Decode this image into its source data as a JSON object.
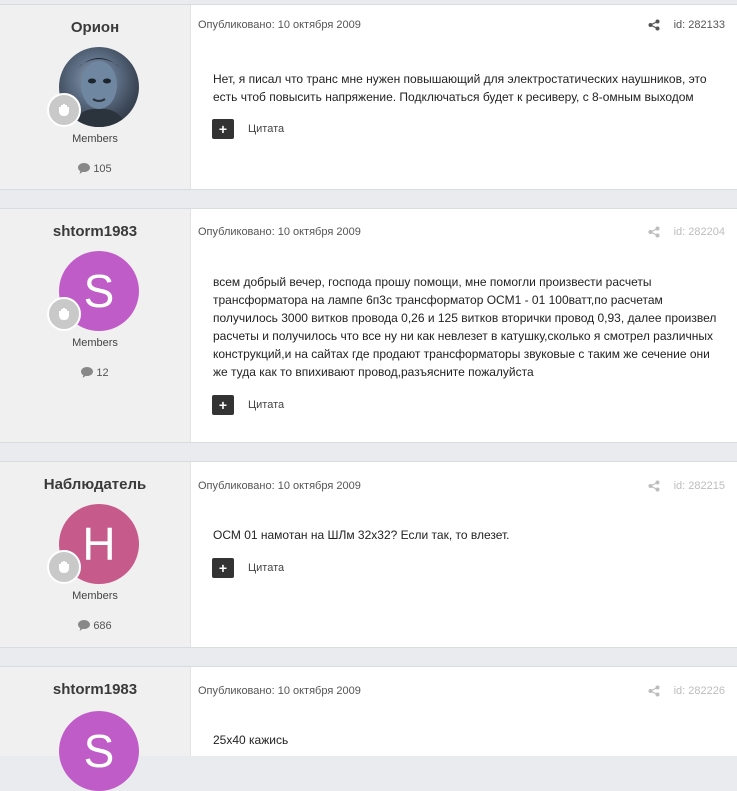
{
  "posts": [
    {
      "author": "Орион",
      "group": "Members",
      "post_count": "105",
      "date": "Опубликовано: 10 октября 2009",
      "id_label": "id: 282133",
      "content_lines": [
        "Нет, я писал что транс мне нужен повышающий для электростатических наушников, это",
        "есть чтоб повысить напряжение. Подключаться будет к ресиверу, с 8-омным выходом"
      ],
      "quote_label": "Цитата"
    },
    {
      "author": "shtorm1983",
      "avatar_letter": "S",
      "group": "Members",
      "post_count": "12",
      "date": "Опубликовано: 10 октября 2009",
      "id_label": "id: 282204",
      "content_lines": [
        "всем добрый вечер, господа прошу помощи, мне помогли произвести расчеты",
        "трансформатора на лампе 6п3с трансформатор ОСМ1 - 01 100ватт,по расчетам",
        "получилось 3000 витков провода 0,26 и 125 витков вторички провод 0,93, далее произвел",
        "расчеты и получилось что все ну ни как невлезет в катушку,сколько я смотрел различных",
        "конструкций,и на сайтах где продают трансформаторы звуковые с таким же сечение они",
        "же туда как то впихивают провод,разъясните пожалуйста"
      ],
      "quote_label": "Цитата"
    },
    {
      "author": "Наблюдатель",
      "avatar_letter": "H",
      "group": "Members",
      "post_count": "686",
      "date": "Опубликовано: 10 октября 2009",
      "id_label": "id: 282215",
      "content_lines": [
        "ОСМ 01 намотан на ШЛм 32х32? Если так, то влезет."
      ],
      "quote_label": "Цитата"
    },
    {
      "author": "shtorm1983",
      "avatar_letter": "S",
      "date": "Опубликовано: 10 октября 2009",
      "id_label": "id: 282226",
      "content_lines": [
        "25х40 кажись"
      ]
    }
  ],
  "colors": {
    "avatar_s": "#c05cc8",
    "avatar_h": "#c65a8a",
    "author_panel": "#f0f0f0",
    "page_bg": "#e9ebef"
  },
  "icons": {
    "share": "share-icon",
    "comment": "comment-icon",
    "rank": "rank-badge-icon",
    "quote": "plus-icon"
  }
}
